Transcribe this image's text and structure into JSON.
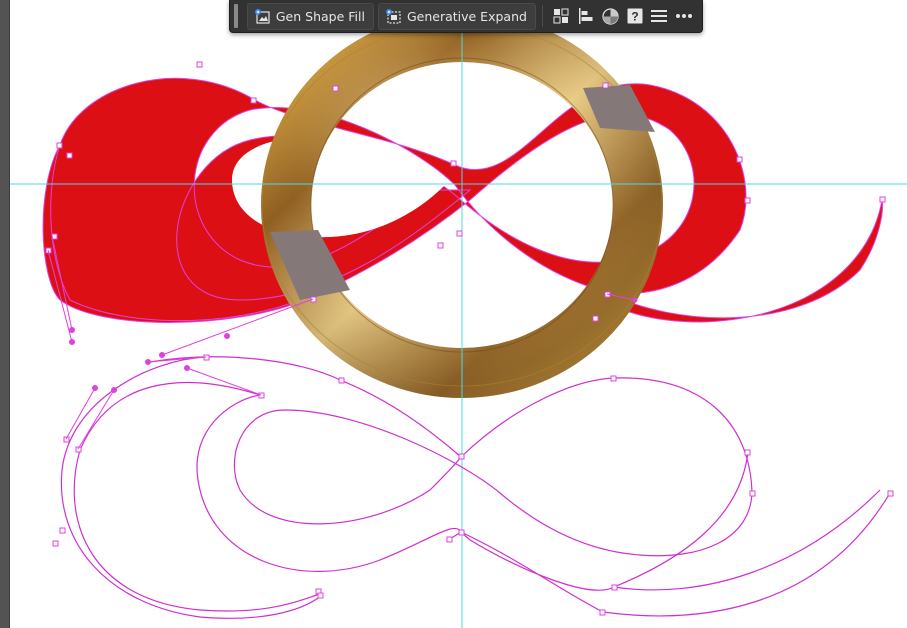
{
  "colors": {
    "workspace_gutter": "#535353",
    "toolbar_bg": "#323232",
    "button_bg": "#3d3d3d",
    "label_text": "#e6e6e6",
    "ribbon_red": "#dc1014",
    "selection_magenta": "#e040e0",
    "guide_cyan": "#4dd9e8",
    "ring_gold": "#c89a40",
    "overlap_gray": "#847879"
  },
  "contextual_taskbar": {
    "gen_shape_fill": {
      "label": "Gen Shape Fill",
      "icon": "sparkle-shape-icon"
    },
    "generative_expand": {
      "label": "Generative Expand",
      "icon": "sparkle-expand-icon"
    },
    "icons": [
      {
        "name": "grid-transform-icon"
      },
      {
        "name": "align-left-icon"
      },
      {
        "name": "recolor-icon"
      },
      {
        "name": "help-icon",
        "glyph": "?"
      },
      {
        "name": "hamburger-menu-icon"
      },
      {
        "name": "more-options-icon"
      }
    ]
  }
}
